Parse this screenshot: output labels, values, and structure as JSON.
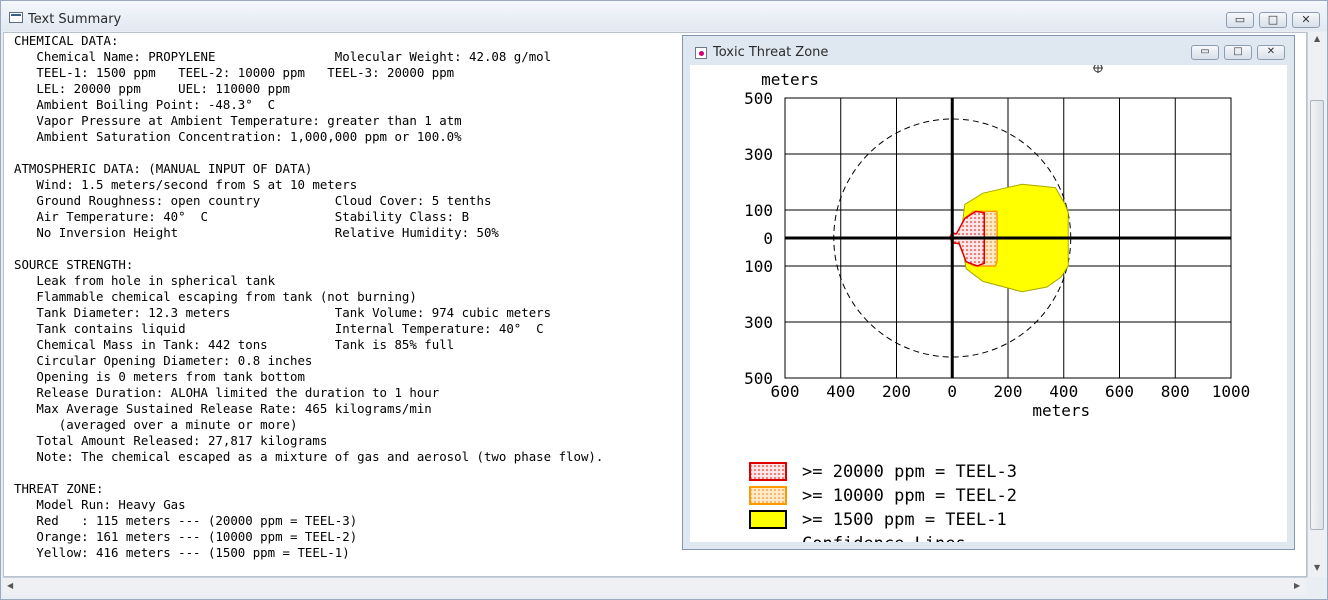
{
  "window": {
    "title": "Text Summary",
    "icon": "text-window-icon",
    "controls": {
      "minimize": "▭",
      "maximize": "□",
      "close": "✕"
    }
  },
  "summary_lines": [
    "CHEMICAL DATA:",
    "   Chemical Name: PROPYLENE                Molecular Weight: 42.08 g/mol",
    "   TEEL-1: 1500 ppm   TEEL-2: 10000 ppm   TEEL-3: 20000 ppm",
    "   LEL: 20000 ppm     UEL: 110000 ppm",
    "   Ambient Boiling Point: -48.3°  C",
    "   Vapor Pressure at Ambient Temperature: greater than 1 atm",
    "   Ambient Saturation Concentration: 1,000,000 ppm or 100.0%",
    "",
    "ATMOSPHERIC DATA: (MANUAL INPUT OF DATA)",
    "   Wind: 1.5 meters/second from S at 10 meters",
    "   Ground Roughness: open country          Cloud Cover: 5 tenths",
    "   Air Temperature: 40°  C                 Stability Class: B",
    "   No Inversion Height                     Relative Humidity: 50%",
    "",
    "SOURCE STRENGTH:",
    "   Leak from hole in spherical tank",
    "   Flammable chemical escaping from tank (not burning)",
    "   Tank Diameter: 12.3 meters              Tank Volume: 974 cubic meters",
    "   Tank contains liquid                    Internal Temperature: 40°  C",
    "   Chemical Mass in Tank: 442 tons         Tank is 85% full",
    "   Circular Opening Diameter: 0.8 inches",
    "   Opening is 0 meters from tank bottom",
    "   Release Duration: ALOHA limited the duration to 1 hour",
    "   Max Average Sustained Release Rate: 465 kilograms/min",
    "      (averaged over a minute or more)",
    "   Total Amount Released: 27,817 kilograms",
    "   Note: The chemical escaped as a mixture of gas and aerosol (two phase flow).",
    "",
    "THREAT ZONE:",
    "   Model Run: Heavy Gas",
    "   Red   : 115 meters --- (20000 ppm = TEEL-3)",
    "   Orange: 161 meters --- (10000 ppm = TEEL-2)",
    "   Yellow: 416 meters --- (1500 ppm = TEEL-1)"
  ],
  "threat_window": {
    "title": "Toxic Threat Zone",
    "icon": "threat-zone-icon",
    "controls": {
      "minimize": "▭",
      "maximize": "□",
      "close": "✕"
    }
  },
  "chart_data": {
    "type": "area",
    "ylabel": "meters",
    "xlabel": "meters",
    "xlim": [
      -600,
      1000
    ],
    "ylim": [
      -500,
      500
    ],
    "x_ticks": [
      -600,
      -400,
      -200,
      0,
      200,
      400,
      600,
      800,
      1000
    ],
    "x_tick_labels": [
      "600",
      "400",
      "200",
      "0",
      "200",
      "400",
      "600",
      "800",
      "1000"
    ],
    "y_ticks": [
      500,
      300,
      100,
      0,
      -100,
      -300,
      -500
    ],
    "y_tick_labels": [
      "500",
      "300",
      "100",
      "0",
      "100",
      "300",
      "500"
    ],
    "grid": true,
    "confidence_circle": {
      "center": [
        0,
        0
      ],
      "radius": 425
    },
    "zones": [
      {
        "name": "TEEL-1",
        "fill": "#ffff00",
        "stroke": "#a8a800",
        "points": [
          [
            30,
            0
          ],
          [
            45,
            120
          ],
          [
            110,
            160
          ],
          [
            250,
            192
          ],
          [
            370,
            180
          ],
          [
            405,
            120
          ],
          [
            416,
            90
          ],
          [
            416,
            -100
          ],
          [
            390,
            -140
          ],
          [
            340,
            -175
          ],
          [
            250,
            -192
          ],
          [
            110,
            -155
          ],
          [
            50,
            -110
          ],
          [
            30,
            0
          ]
        ]
      },
      {
        "name": "TEEL-2",
        "fill": "#ffe0b0",
        "stroke": "#ff9900",
        "points": [
          [
            5,
            0
          ],
          [
            20,
            15
          ],
          [
            50,
            75
          ],
          [
            75,
            95
          ],
          [
            160,
            95
          ],
          [
            161,
            60
          ],
          [
            161,
            -80
          ],
          [
            155,
            -100
          ],
          [
            80,
            -100
          ],
          [
            50,
            -85
          ],
          [
            25,
            -20
          ],
          [
            5,
            0
          ]
        ]
      },
      {
        "name": "TEEL-3",
        "fill": "#ffd7d7",
        "stroke": "#e00000",
        "points": [
          [
            -10,
            0
          ],
          [
            0,
            18
          ],
          [
            15,
            15
          ],
          [
            45,
            70
          ],
          [
            85,
            95
          ],
          [
            115,
            90
          ],
          [
            115,
            -90
          ],
          [
            90,
            -100
          ],
          [
            50,
            -85
          ],
          [
            25,
            -20
          ],
          [
            5,
            -18
          ],
          [
            -10,
            0
          ]
        ]
      }
    ],
    "legend": {
      "placement": "bottom-left",
      "items": [
        {
          "label": ">= 20000 ppm = TEEL-3",
          "fill": "#ffd7d7",
          "stroke": "#e00000"
        },
        {
          "label": ">= 10000 ppm = TEEL-2",
          "fill": "#ffe0b0",
          "stroke": "#ff9900"
        },
        {
          "label": ">= 1500 ppm = TEEL-1",
          "fill": "#ffff00",
          "stroke": "#000000"
        },
        {
          "label": "Confidence Lines",
          "line": "#000000"
        }
      ]
    }
  }
}
